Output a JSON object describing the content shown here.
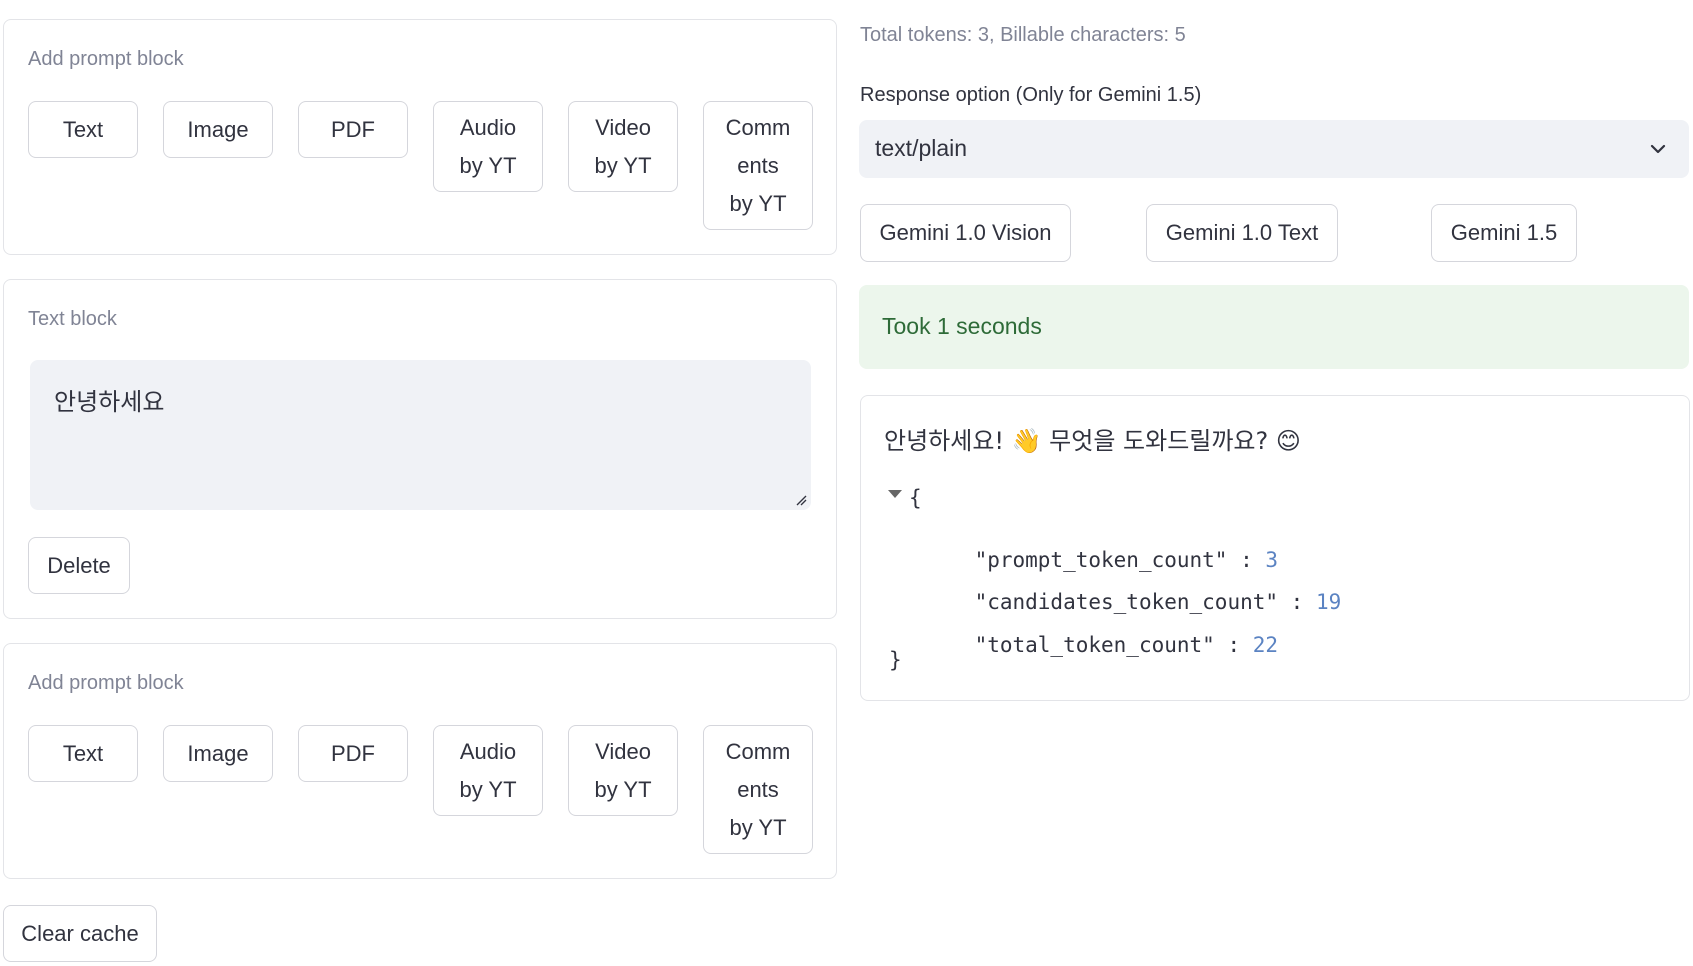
{
  "top_add_block": {
    "caption": "Add prompt block",
    "buttons": {
      "text": "Text",
      "image": "Image",
      "pdf": "PDF",
      "audio": [
        "Audio",
        "by YT"
      ],
      "video": [
        "Video",
        "by YT"
      ],
      "comments": [
        "Comm",
        "ents",
        "by YT"
      ]
    }
  },
  "text_block": {
    "caption": "Text block",
    "value": "안녕하세요",
    "delete_label": "Delete"
  },
  "bottom_add_block": {
    "caption": "Add prompt block",
    "buttons": {
      "text": "Text",
      "image": "Image",
      "pdf": "PDF",
      "audio": [
        "Audio",
        "by YT"
      ],
      "video": [
        "Video",
        "by YT"
      ],
      "comments": [
        "Comm",
        "ents",
        "by YT"
      ]
    }
  },
  "clear_cache_label": "Clear cache",
  "stats": "Total tokens: 3, Billable characters: 5",
  "response_option": {
    "label": "Response option (Only for Gemini 1.5)",
    "selected": "text/plain"
  },
  "models": [
    "Gemini 1.0 Vision",
    "Gemini 1.0 Text",
    "Gemini 1.5"
  ],
  "status": "Took 1 seconds",
  "response": {
    "text": "안녕하세요! 👋 무엇을 도와드릴까요? 😊",
    "json": {
      "open": "{",
      "close": "}",
      "fields": [
        {
          "key": "\"prompt_token_count\"",
          "value": "3"
        },
        {
          "key": "\"candidates_token_count\"",
          "value": "19"
        },
        {
          "key": "\"total_token_count\"",
          "value": "22"
        }
      ]
    }
  },
  "colors": {
    "accent_success_bg": "#ecf6ec",
    "accent_success_text": "#2e6b38",
    "json_number": "#5b83c2"
  }
}
